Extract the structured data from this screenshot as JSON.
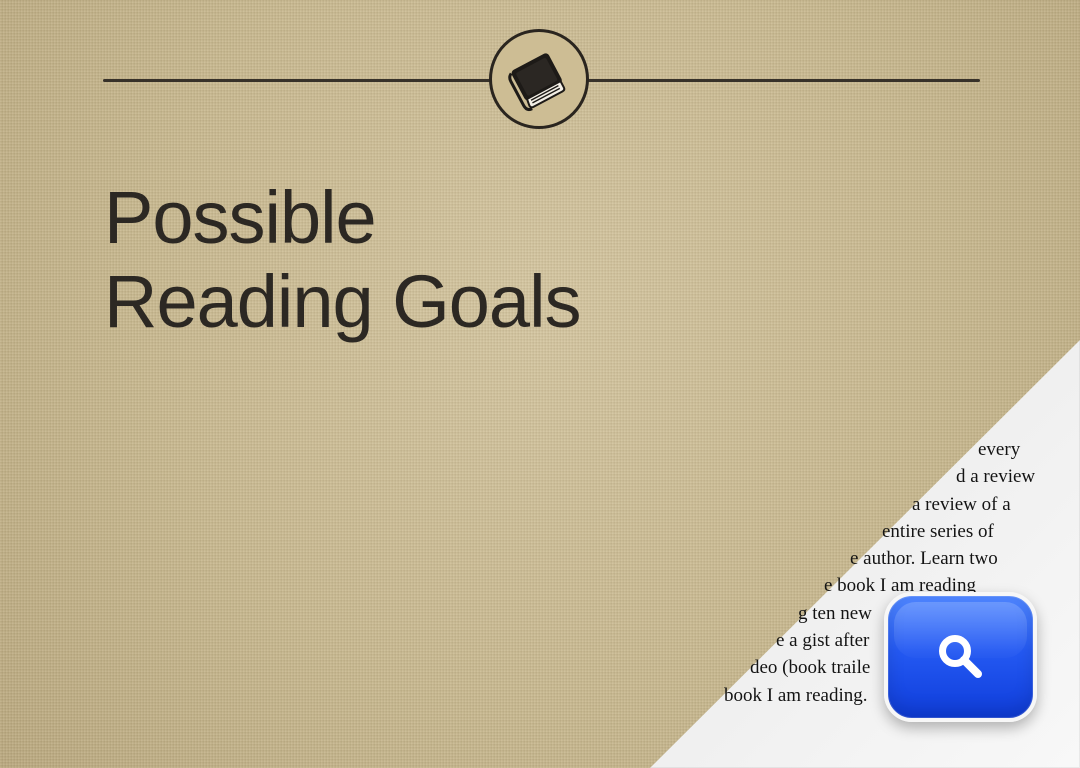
{
  "header": {
    "emblem_icon": "book-icon"
  },
  "content": {
    "title_lines": [
      "Possible",
      "Reading Goals"
    ]
  },
  "page_curl": {
    "lines": [
      "every",
      "d a review",
      "a review of a",
      "entire series of",
      "e author. Learn two",
      "e book I am reading",
      "g ten new",
      "e a gist after",
      "deo (book traile",
      "book I am reading."
    ]
  },
  "search": {
    "icon": "search-icon",
    "color_top": "#4f86ff",
    "color_bottom": "#0f3ddb"
  },
  "colors": {
    "background": "#c9b98f",
    "text": "#2c2823",
    "rule": "#2f2a24",
    "curl": "#e7e7e7"
  }
}
